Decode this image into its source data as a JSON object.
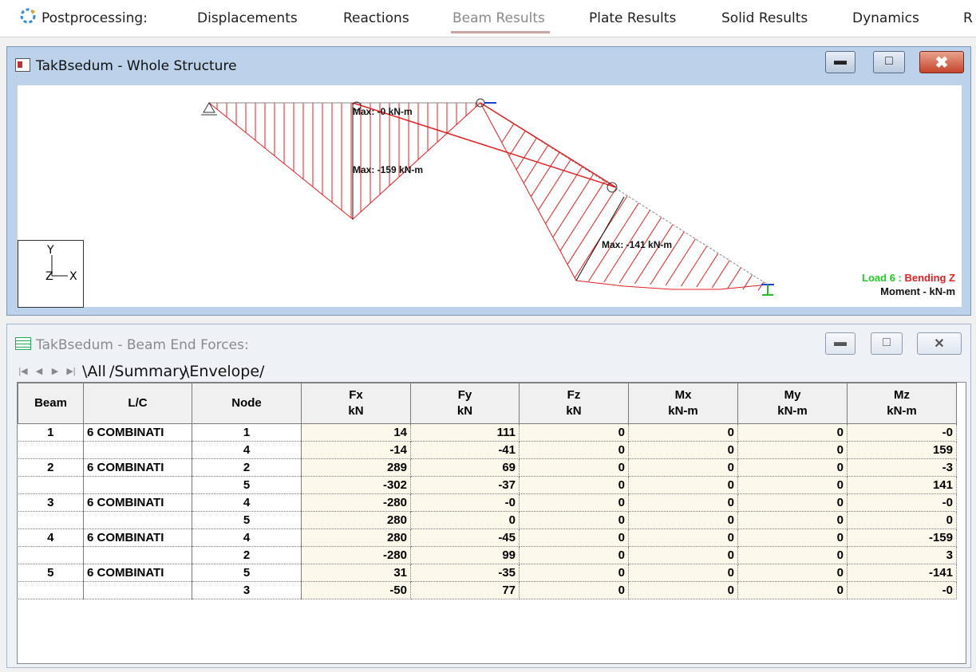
{
  "topbar": {
    "label": "Postprocessing:",
    "tabs": [
      "Displacements",
      "Reactions",
      "Beam Results",
      "Plate Results",
      "Solid Results",
      "Dynamics",
      "R"
    ],
    "active_tab": "Beam Results"
  },
  "diagram_window": {
    "title": "TakBsedum - Whole Structure",
    "labels": {
      "max1": "Max: -0 kN-m",
      "max2": "Max: -159 kN-m",
      "max3": "Max: -141 kN-m"
    },
    "legend_load": "Load 6 : ",
    "legend_bending": "Bending Z",
    "legend_moment": "Moment - kN-m",
    "axis_y": "Y",
    "axis_x": "X",
    "axis_z": "Z"
  },
  "table_window": {
    "title": "TakBsedum - Beam End Forces:",
    "sheet_tabs": [
      "All",
      "Summary",
      "Envelope"
    ],
    "headers": [
      [
        "Beam",
        ""
      ],
      [
        "L/C",
        ""
      ],
      [
        "Node",
        ""
      ],
      [
        "Fx",
        "kN"
      ],
      [
        "Fy",
        "kN"
      ],
      [
        "Fz",
        "kN"
      ],
      [
        "Mx",
        "kN-m"
      ],
      [
        "My",
        "kN-m"
      ],
      [
        "Mz",
        "kN-m"
      ]
    ],
    "rows": [
      [
        "1",
        "6 COMBINATI",
        "1",
        "14",
        "111",
        "0",
        "0",
        "0",
        "-0"
      ],
      [
        "",
        "",
        "4",
        "-14",
        "-41",
        "0",
        "0",
        "0",
        "159"
      ],
      [
        "2",
        "6 COMBINATI",
        "2",
        "289",
        "69",
        "0",
        "0",
        "0",
        "-3"
      ],
      [
        "",
        "",
        "5",
        "-302",
        "-37",
        "0",
        "0",
        "0",
        "141"
      ],
      [
        "3",
        "6 COMBINATI",
        "4",
        "-280",
        "-0",
        "0",
        "0",
        "0",
        "-0"
      ],
      [
        "",
        "",
        "5",
        "280",
        "0",
        "0",
        "0",
        "0",
        "0"
      ],
      [
        "4",
        "6 COMBINATI",
        "4",
        "280",
        "-45",
        "0",
        "0",
        "0",
        "-159"
      ],
      [
        "",
        "",
        "2",
        "-280",
        "99",
        "0",
        "0",
        "0",
        "3"
      ],
      [
        "5",
        "6 COMBINATI",
        "5",
        "31",
        "-35",
        "0",
        "0",
        "0",
        "-141"
      ],
      [
        "",
        "",
        "3",
        "-50",
        "77",
        "0",
        "0",
        "0",
        "-0"
      ]
    ]
  },
  "colors": {
    "moment_line": "#e02020",
    "load_text": "#22cc22",
    "support": "#1a3fd6",
    "fixed_support": "#22bb22"
  }
}
